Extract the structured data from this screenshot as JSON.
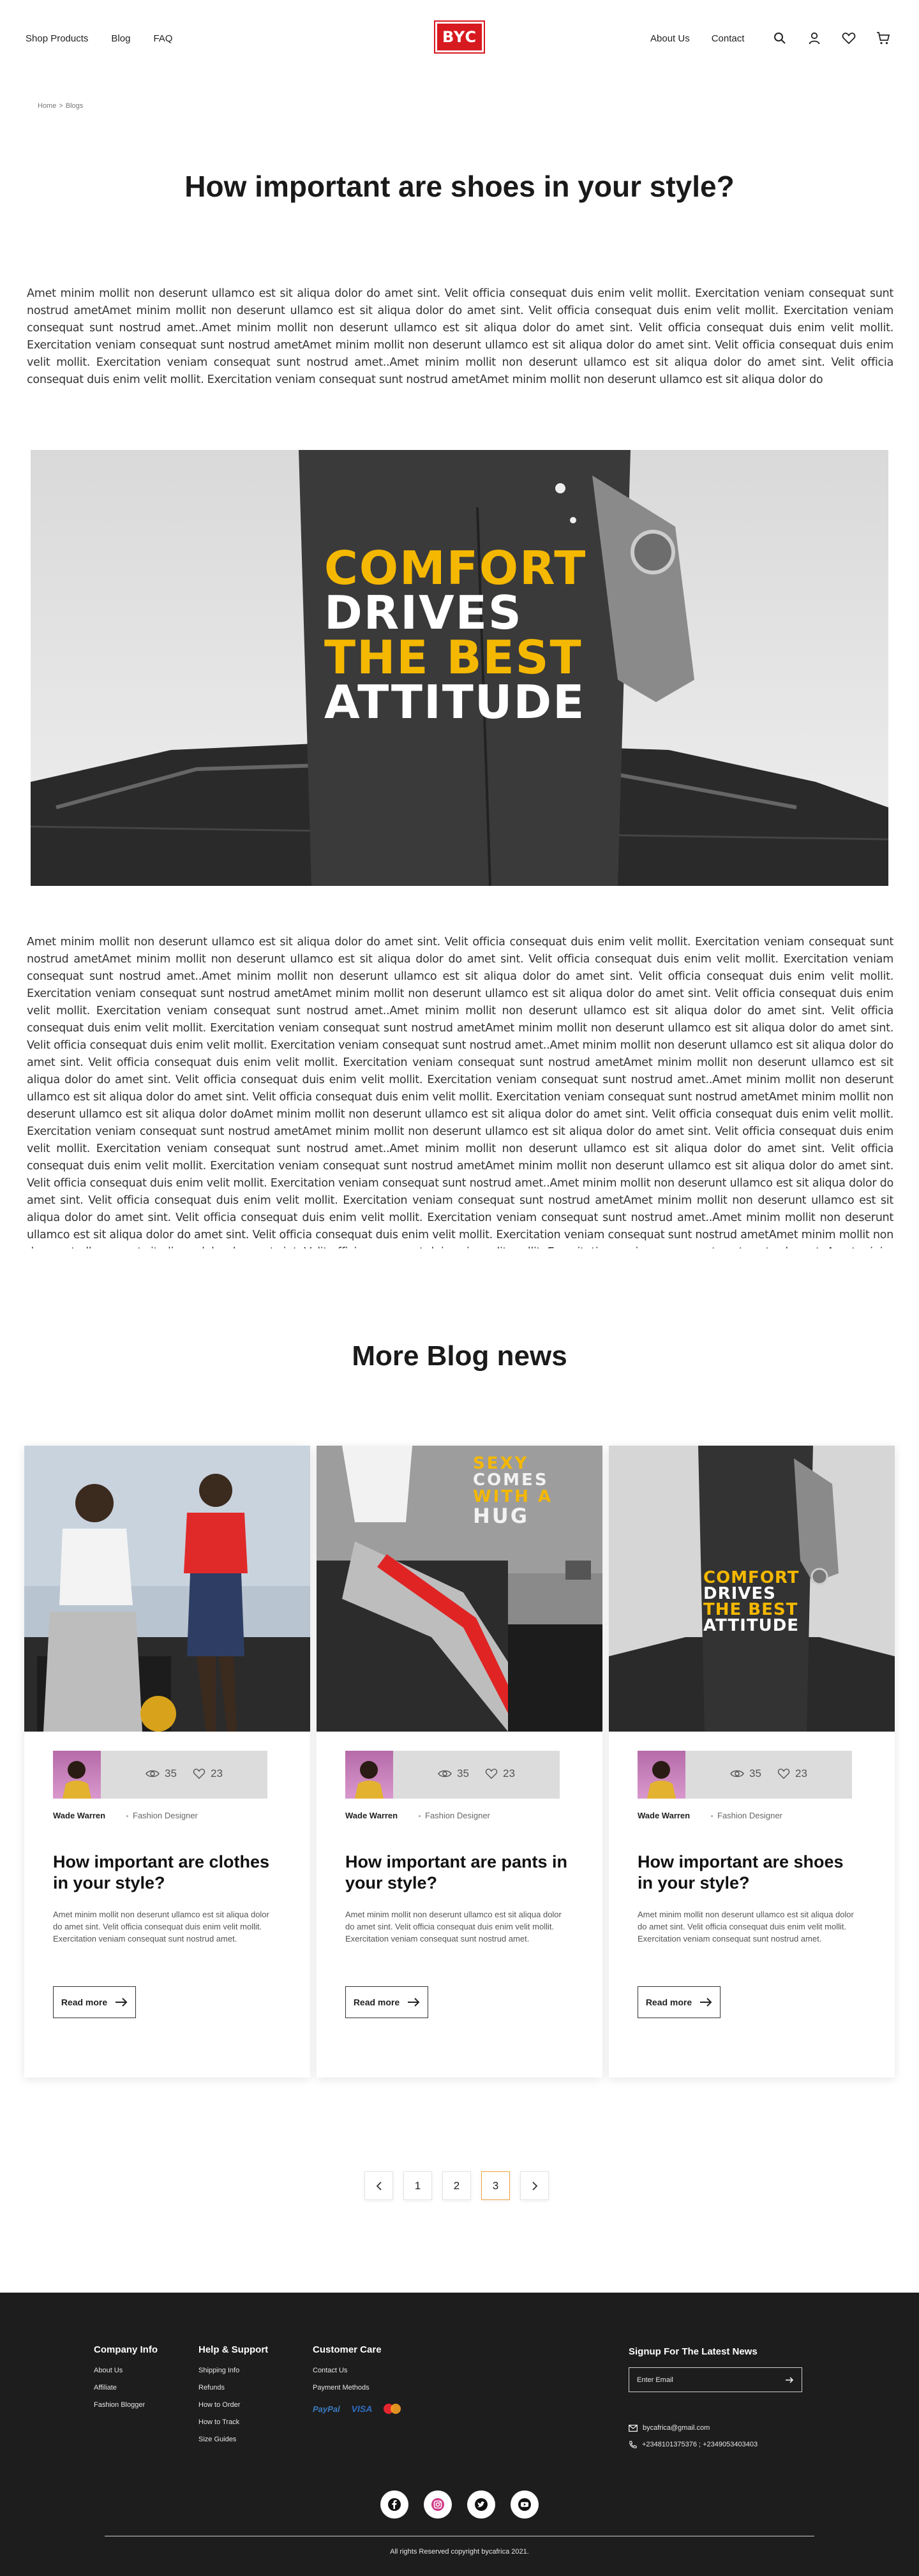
{
  "header": {
    "nav_left": [
      "Shop Products",
      "Blog",
      "FAQ"
    ],
    "logo_text": "BYC",
    "nav_right": [
      "About Us",
      "Contact"
    ],
    "icons": [
      "search-icon",
      "user-icon",
      "heart-icon",
      "cart-icon"
    ]
  },
  "breadcrumb": {
    "home": "Home",
    "separator": ">",
    "current": "Blogs"
  },
  "article": {
    "title": "How important are shoes in your style?",
    "paragraph_1": "Amet minim mollit non deserunt ullamco est sit aliqua dolor do amet sint. Velit officia consequat duis enim velit mollit. Exercitation veniam consequat sunt nostrud ametAmet minim mollit non deserunt ullamco est sit aliqua dolor do amet sint. Velit officia consequat duis enim velit mollit. Exercitation veniam consequat sunt nostrud amet..Amet minim mollit non deserunt ullamco est sit aliqua dolor do amet sint. Velit officia consequat duis enim velit mollit. Exercitation veniam consequat sunt nostrud ametAmet minim mollit non deserunt ullamco est sit aliqua dolor do amet sint. Velit officia consequat duis enim velit mollit. Exercitation veniam consequat sunt nostrud amet..Amet minim mollit non deserunt ullamco est sit aliqua dolor do amet sint. Velit officia consequat duis enim velit mollit. Exercitation veniam consequat sunt nostrud ametAmet minim mollit non deserunt ullamco est sit aliqua dolor do",
    "hero_text": [
      "COMFORT",
      "DRIVES",
      "THE BEST",
      "ATTITUDE"
    ],
    "paragraph_2": "Amet minim mollit non deserunt ullamco est sit aliqua dolor do amet sint. Velit officia consequat duis enim velit mollit. Exercitation veniam consequat sunt nostrud ametAmet minim mollit non deserunt ullamco est sit aliqua dolor do amet sint. Velit officia consequat duis enim velit mollit. Exercitation veniam consequat sunt nostrud amet..Amet minim mollit non deserunt ullamco est sit aliqua dolor do amet sint. Velit officia consequat duis enim velit mollit. Exercitation veniam consequat sunt nostrud ametAmet minim mollit non deserunt ullamco est sit aliqua dolor do amet sint. Velit officia consequat duis enim velit mollit. Exercitation veniam consequat sunt nostrud amet..Amet minim mollit non deserunt ullamco est sit aliqua dolor do amet sint. Velit officia consequat duis enim velit mollit. Exercitation veniam consequat sunt nostrud ametAmet minim mollit non deserunt ullamco est sit aliqua dolor do amet sint. Velit officia consequat duis enim velit mollit. Exercitation veniam consequat sunt nostrud amet..Amet minim mollit non deserunt ullamco est sit aliqua dolor do amet sint. Velit officia consequat duis enim velit mollit. Exercitation veniam consequat sunt nostrud ametAmet minim mollit non deserunt ullamco est sit aliqua dolor do amet sint. Velit officia consequat duis enim velit mollit. Exercitation veniam consequat sunt nostrud amet..Amet minim mollit non deserunt ullamco est sit aliqua dolor do amet sint. Velit officia consequat duis enim velit mollit. Exercitation veniam consequat sunt nostrud ametAmet minim mollit non deserunt ullamco est sit aliqua dolor doAmet minim mollit non deserunt ullamco est sit aliqua dolor do amet sint. Velit officia consequat duis enim velit mollit. Exercitation veniam consequat sunt nostrud ametAmet minim mollit non deserunt ullamco est sit aliqua dolor do amet sint. Velit officia consequat duis enim velit mollit. Exercitation veniam consequat sunt nostrud amet..Amet minim mollit non deserunt ullamco est sit aliqua dolor do amet sint. Velit officia consequat duis enim velit mollit. Exercitation veniam consequat sunt nostrud ametAmet minim mollit non deserunt ullamco est sit aliqua dolor do amet sint. Velit officia consequat duis enim velit mollit. Exercitation veniam consequat sunt nostrud amet..Amet minim mollit non deserunt ullamco est sit aliqua dolor do amet sint. Velit officia consequat duis enim velit mollit. Exercitation veniam consequat sunt nostrud ametAmet minim mollit non deserunt ullamco est sit aliqua dolor do amet sint. Velit officia consequat duis enim velit mollit. Exercitation veniam consequat sunt nostrud amet..Amet minim mollit non deserunt ullamco est sit aliqua dolor do amet sint. Velit officia consequat duis enim velit mollit. Exercitation veniam consequat sunt nostrud ametAmet minim mollit non deserunt ullamco est sit aliqua dolor do amet sint. Velit officia consequat duis enim velit mollit. Exercitation veniam consequat sunt nostrud amet..Amet minim mollit non deserunt ullamco est sit aliqua dolor do amet sint. Velit officia consequat duis enim velit mollit. Exercitation veniam consequat sunt nostrud ametAmet minim mollit non deserunt ullamco est sit aliqua dolor do"
  },
  "more_blog": {
    "title": "More Blog news",
    "cards": [
      {
        "views": "35",
        "likes": "23",
        "author": "Wade Warren",
        "role": "Fashion Designer",
        "title": "How important are clothes in your style?",
        "desc": "Amet minim mollit non deserunt ullamco est sit aliqua dolor do amet sint. Velit officia consequat duis enim velit mollit. Exercitation veniam consequat sunt nostrud amet.",
        "read_more": "Read more"
      },
      {
        "views": "35",
        "likes": "23",
        "author": "Wade Warren",
        "role": "Fashion Designer",
        "title": "How important are pants in your style?",
        "desc": "Amet minim mollit non deserunt ullamco est sit aliqua dolor do amet sint. Velit officia consequat duis enim velit mollit. Exercitation veniam consequat sunt nostrud amet.",
        "read_more": "Read more",
        "image_text": [
          "SEXY",
          "COMES",
          "WITH A",
          "HUG"
        ]
      },
      {
        "views": "35",
        "likes": "23",
        "author": "Wade Warren",
        "role": "Fashion Designer",
        "title": "How important are shoes in your style?",
        "desc": "Amet minim mollit non deserunt ullamco est sit aliqua dolor do amet sint. Velit officia consequat duis enim velit mollit. Exercitation veniam consequat sunt nostrud amet.",
        "read_more": "Read more",
        "image_text": [
          "COMFORT",
          "DRIVES",
          "THE BEST",
          "ATTITUDE"
        ]
      }
    ]
  },
  "pagination": {
    "pages": [
      "1",
      "2",
      "3"
    ],
    "active": "3"
  },
  "footer": {
    "company_info": {
      "heading": "Company Info",
      "links": [
        "About Us",
        "Affiliate",
        "Fashion Blogger"
      ]
    },
    "help_support": {
      "heading": "Help & Support",
      "links": [
        "Shipping Info",
        "Refunds",
        "How to Order",
        "How to Track",
        "Size Guides"
      ]
    },
    "customer_care": {
      "heading": "Customer Care",
      "links": [
        "Contact Us",
        "Payment Methods"
      ],
      "payments": [
        "PayPal",
        "VISA"
      ]
    },
    "signup": {
      "heading": "Signup For The Latest News",
      "placeholder": "Enter Email"
    },
    "email": "bycafrica@gmail.com",
    "phone": "+2348101375376 ; +2349053403403",
    "socials": [
      "facebook-icon",
      "instagram-icon",
      "twitter-icon",
      "youtube-icon"
    ],
    "copyright": "All rights Reserved  copyright bycafrica 2021."
  },
  "colors": {
    "brand_red": "#d71920",
    "accent_yellow": "#f5b800",
    "footer_bg": "#1d1d1d",
    "active_page_border": "#f0a040"
  }
}
